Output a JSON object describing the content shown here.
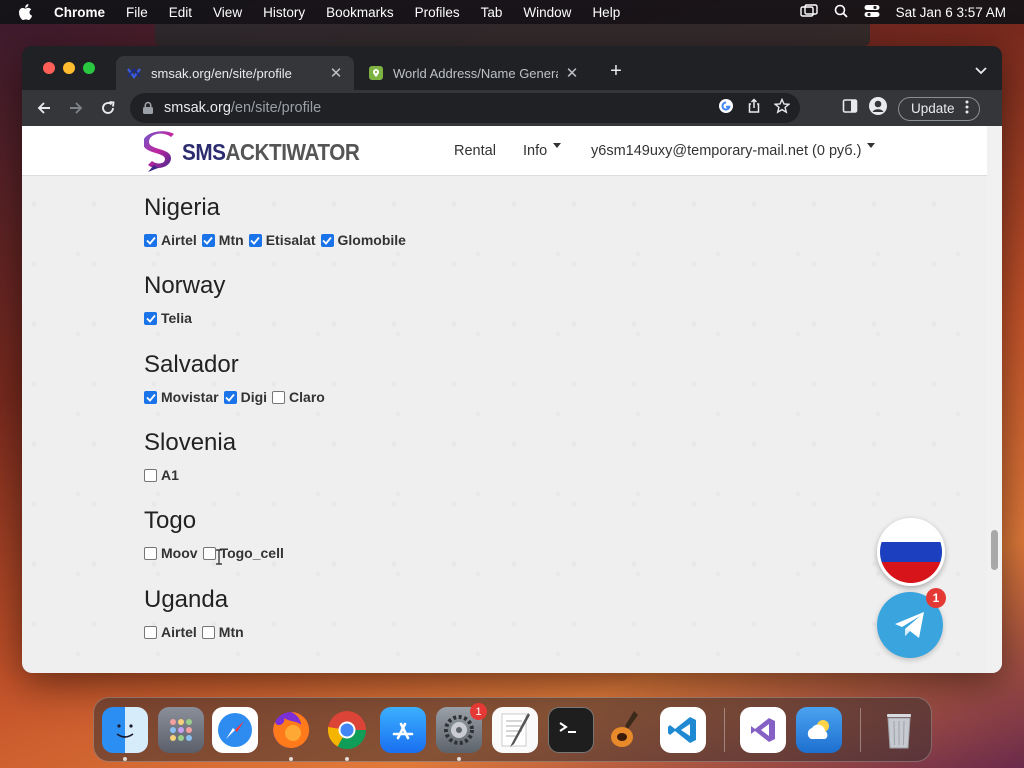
{
  "menubar": {
    "app": "Chrome",
    "items": [
      "File",
      "Edit",
      "View",
      "History",
      "Bookmarks",
      "Profiles",
      "Tab",
      "Window",
      "Help"
    ],
    "datetime": "Sat Jan 6  3:57 AM"
  },
  "tabs": [
    {
      "title": "smsak.org/en/site/profile",
      "icon": "smsak-favicon"
    },
    {
      "title": "World Address/Name Generato",
      "icon": "location-favicon"
    }
  ],
  "omnibox": {
    "host": "smsak.org",
    "path": "/en/site/profile"
  },
  "toolbar": {
    "update_label": "Update"
  },
  "site": {
    "logo_a": "SMS",
    "logo_b": "ACKTIWATOR",
    "nav": {
      "rental": "Rental",
      "info": "Info",
      "account": "y6sm149uxy@temporary-mail.net (0 руб.)"
    }
  },
  "countries": [
    {
      "name": "Nigeria",
      "operators": [
        {
          "label": "Airtel",
          "checked": true
        },
        {
          "label": "Mtn",
          "checked": true
        },
        {
          "label": "Etisalat",
          "checked": true
        },
        {
          "label": "Glomobile",
          "checked": true
        }
      ]
    },
    {
      "name": "Norway",
      "operators": [
        {
          "label": "Telia",
          "checked": true
        }
      ]
    },
    {
      "name": "Salvador",
      "operators": [
        {
          "label": "Movistar",
          "checked": true
        },
        {
          "label": "Digi",
          "checked": true
        },
        {
          "label": "Claro",
          "checked": false
        }
      ]
    },
    {
      "name": "Slovenia",
      "operators": [
        {
          "label": "A1",
          "checked": false
        }
      ]
    },
    {
      "name": "Togo",
      "operators": [
        {
          "label": "Moov",
          "checked": false
        },
        {
          "label": "Togo_cell",
          "checked": false
        }
      ]
    },
    {
      "name": "Uganda",
      "operators": [
        {
          "label": "Airtel",
          "checked": false
        },
        {
          "label": "Mtn",
          "checked": false
        }
      ]
    }
  ],
  "telegram_badge": "1",
  "dock": {
    "settings_badge": "1"
  },
  "colors": {
    "checkbox_on": "#1a73e8",
    "telegram": "#3aa4de",
    "badge": "#e53935"
  }
}
